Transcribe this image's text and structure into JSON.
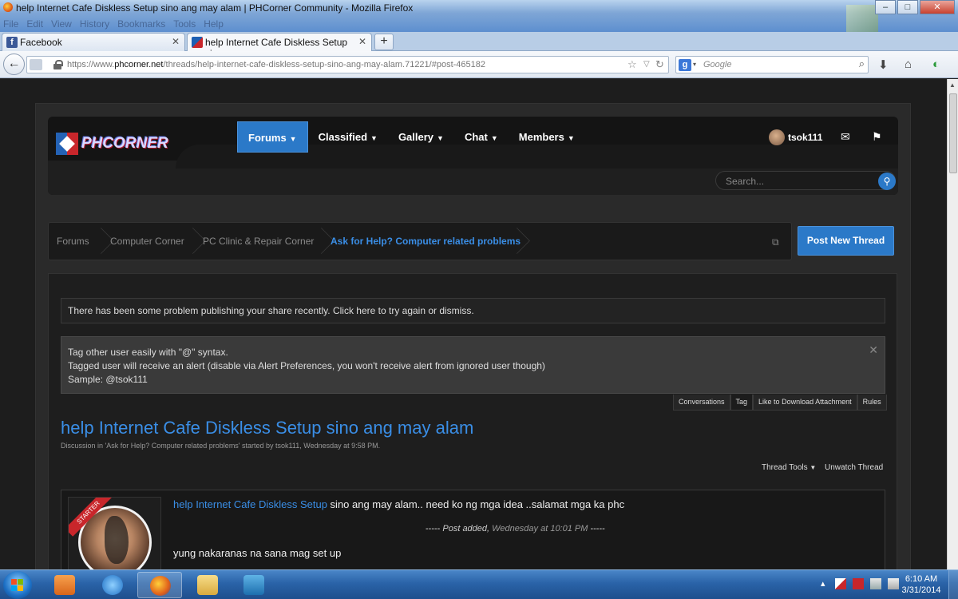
{
  "window": {
    "title": "help Internet Cafe Diskless Setup sino ang may alam | PHCorner Community - Mozilla Firefox",
    "menu": [
      "File",
      "Edit",
      "View",
      "History",
      "Bookmarks",
      "Tools",
      "Help"
    ],
    "controls": {
      "minimize": "–",
      "maximize": "□",
      "close": "✕"
    }
  },
  "tabs": [
    {
      "label": "Facebook",
      "icon": "facebook-favicon"
    },
    {
      "label": "help Internet Cafe Diskless Setup sino...",
      "icon": "phcorner-favicon",
      "active": true
    }
  ],
  "newtab_label": "+",
  "navbar": {
    "url_prefix": "https://www.",
    "url_domain": "phcorner.net",
    "url_path": "/threads/help-internet-cafe-diskless-setup-sino-ang-may-alam.71221/#post-465182",
    "search_placeholder": "Google"
  },
  "site": {
    "logo_text": "PHCORNER",
    "nav": [
      {
        "label": "Forums",
        "active": true
      },
      {
        "label": "Classified"
      },
      {
        "label": "Gallery"
      },
      {
        "label": "Chat"
      },
      {
        "label": "Members"
      }
    ],
    "username": "tsok111",
    "search_placeholder": "Search..."
  },
  "breadcrumb": [
    {
      "label": "Forums"
    },
    {
      "label": "Computer Corner"
    },
    {
      "label": "PC Clinic & Repair Corner"
    },
    {
      "label": "Ask for Help? Computer related problems",
      "active": true
    }
  ],
  "post_new_thread": "Post New Thread",
  "notices": {
    "share_problem": "There has been some problem publishing your share recently. Click here to try again or dismiss.",
    "tag_line1": "Tag other user easily with \"@\" syntax.",
    "tag_line2": "Tagged user will receive an alert (disable via Alert Preferences, you won't receive alert from ignored user though)",
    "tag_line3": "Sample: @tsok111"
  },
  "notice_tabs": [
    {
      "label": "Conversations"
    },
    {
      "label": "Tag",
      "active": true
    },
    {
      "label": "Like to Download Attachment"
    },
    {
      "label": "Rules"
    }
  ],
  "thread": {
    "title": "help Internet Cafe Diskless Setup sino ang may alam",
    "description": "Discussion in 'Ask for Help? Computer related problems' started by tsok111, Wednesday at 9:58 PM.",
    "tools": "Thread Tools",
    "unwatch": "Unwatch Thread"
  },
  "post": {
    "ribbon": "STARTER",
    "link_text": "help Internet Cafe Diskless Setup",
    "text_rest": " sino ang may alam.. need ko ng mga idea ..salamat mga ka phc",
    "added_prefix": "----- ",
    "added_label": "Post added,",
    "added_time": "Wednesday at 10:01 PM",
    "added_suffix": " -----",
    "text2": "yung nakaranas na sana mag set up"
  },
  "taskbar": {
    "time": "6:10 AM",
    "date": "3/31/2014"
  },
  "colors": {
    "accent": "#2b79c8",
    "link": "#3a8ee6",
    "page_bg": "#1e1e1e",
    "starter_ribbon": "#c8262b"
  }
}
